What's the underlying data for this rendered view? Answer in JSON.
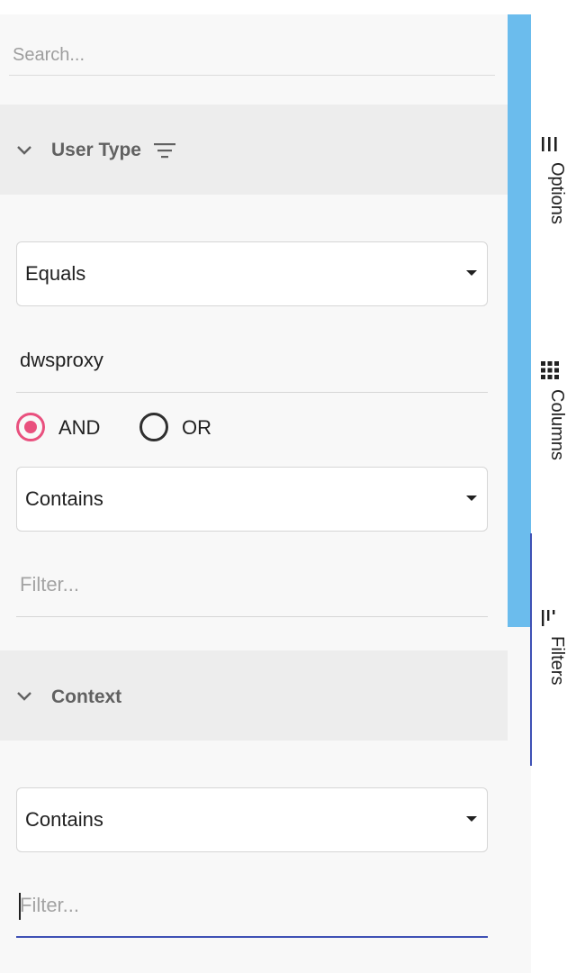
{
  "search": {
    "placeholder": "Search..."
  },
  "groups": [
    {
      "title": "User Type",
      "condition1": {
        "operator": "Equals",
        "value": "dwsproxy"
      },
      "join": {
        "and_label": "AND",
        "or_label": "OR",
        "selected": "AND"
      },
      "condition2": {
        "operator": "Contains",
        "placeholder": "Filter..."
      }
    },
    {
      "title": "Context",
      "condition1": {
        "operator": "Contains",
        "placeholder": "Filter..."
      }
    }
  ],
  "side_tabs": [
    {
      "label": "Options",
      "icon": "menu-lines-icon",
      "active": false
    },
    {
      "label": "Columns",
      "icon": "grid-icon",
      "active": false
    },
    {
      "label": "Filters",
      "icon": "filter-icon",
      "active": true
    }
  ],
  "colors": {
    "accent_radio": "#e9507e",
    "focus_underline": "#3f51b5",
    "side_bar": "#6bbced"
  }
}
